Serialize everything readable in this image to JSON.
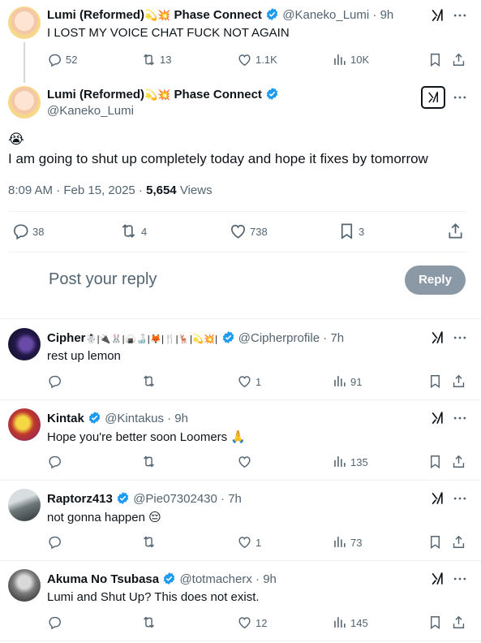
{
  "top_tweet": {
    "name": "Lumi (Reformed)",
    "name_emojis": "💫💥",
    "affiliation": "Phase Connect",
    "handle": "@Kaneko_Lumi",
    "time": "· 9h",
    "text": "I LOST MY VOICE CHAT FUCK NOT AGAIN",
    "replies": "52",
    "reposts": "13",
    "likes": "1.1K",
    "views": "10K"
  },
  "main_tweet": {
    "name": "Lumi (Reformed)",
    "name_emojis": "💫💥",
    "affiliation": "Phase Connect",
    "handle": "@Kaneko_Lumi",
    "emoji_line": "😭",
    "text": "I am going to shut up completely today and hope it fixes by tomorrow",
    "timestamp": "8:09 AM · Feb 15, 2025 ·",
    "views_count": "5,654",
    "views_label": "Views",
    "replies": "38",
    "reposts": "4",
    "likes": "738",
    "bookmarks": "3"
  },
  "reply_box": {
    "placeholder": "Post your reply",
    "button_label": "Reply"
  },
  "replies": [
    {
      "name": "Cipher",
      "name_emojis": "☃️|🔌🐰|🍙🍶|🦊|🍴|🦌|💫💥|",
      "handle": "@Cipherprofile",
      "time": "· 7h",
      "text": "rest up lemon",
      "text_emoji": "",
      "replies": "",
      "reposts": "",
      "likes": "1",
      "views": "91"
    },
    {
      "name": "Kintak",
      "name_emojis": "",
      "handle": "@Kintakus",
      "time": "· 9h",
      "text": "Hope you're better soon Loomers",
      "text_emoji": "🙏",
      "replies": "",
      "reposts": "",
      "likes": "",
      "views": "135"
    },
    {
      "name": "Raptorz413",
      "name_emojis": "",
      "handle": "@Pie07302430",
      "time": "· 7h",
      "text": "not gonna happen",
      "text_emoji": "😔",
      "replies": "",
      "reposts": "",
      "likes": "1",
      "views": "73"
    },
    {
      "name": "Akuma No Tsubasa",
      "name_emojis": "",
      "handle": "@totmacherx",
      "time": "· 9h",
      "text": "Lumi and Shut Up? This does not exist.",
      "text_emoji": "",
      "replies": "",
      "reposts": "",
      "likes": "12",
      "views": "145"
    }
  ],
  "colors": {
    "verified": "#1d9bf0",
    "text": "#0f1419",
    "muted": "#536471",
    "divider": "#eff3f4",
    "reply_button": "#8b98a5"
  },
  "icons": [
    "reply-icon",
    "repost-icon",
    "like-icon",
    "views-icon",
    "bookmark-icon",
    "share-icon",
    "grok-icon",
    "more-icon",
    "verified-icon"
  ]
}
